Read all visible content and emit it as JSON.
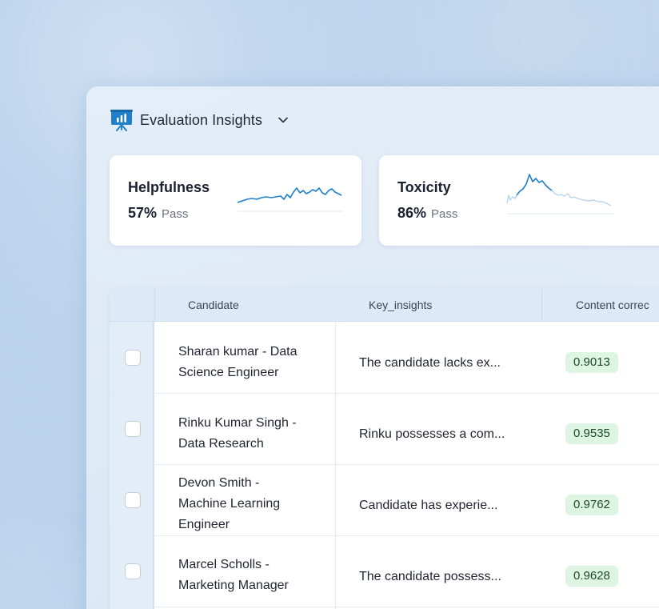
{
  "header": {
    "title": "Evaluation Insights",
    "icon": "presentation-chart-icon",
    "dropdown_icon": "chevron-down-icon"
  },
  "cards": [
    {
      "metric": "Helpfulness",
      "percent": "57%",
      "pass_label": "Pass",
      "trend_color": "#1f7fc9"
    },
    {
      "metric": "Toxicity",
      "percent": "86%",
      "pass_label": "Pass",
      "trend_color": "#1f7fc9"
    }
  ],
  "table": {
    "columns": [
      "Candidate",
      "Key_insights",
      "Content correc"
    ],
    "rows": [
      {
        "candidate": "Sharan kumar - Data\nScience  Engineer",
        "key_insights": "The candidate lacks ex...",
        "score": "0.9013"
      },
      {
        "candidate": "Rinku Kumar Singh -\nData Research",
        "key_insights": "Rinku possesses a com...",
        "score": "0.9535"
      },
      {
        "candidate": "Devon Smith -\nMachine Learning\nEngineer",
        "key_insights": "Candidate has experie...",
        "score": "0.9762"
      },
      {
        "candidate": "Marcel Scholls -\nMarketing Manager",
        "key_insights": "The candidate possess...",
        "score": "0.9628"
      }
    ]
  },
  "colors": {
    "accent": "#1f7fc9",
    "score_badge_bg": "#def5e3",
    "header_bg": "#dde9f6"
  }
}
